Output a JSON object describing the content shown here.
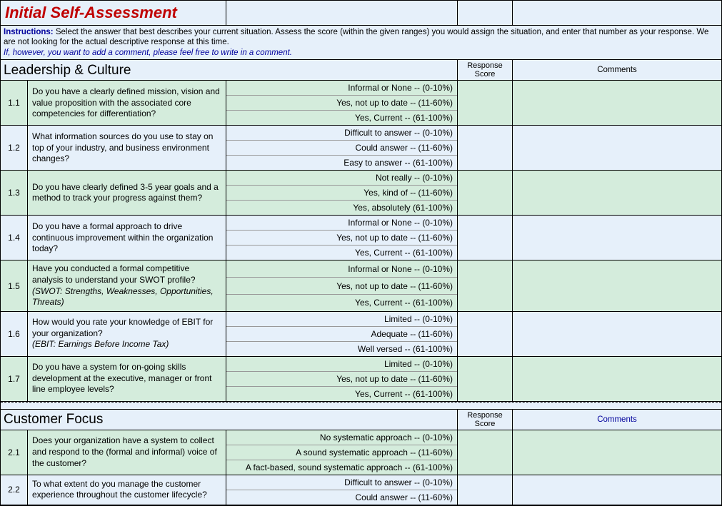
{
  "title": "Initial Self-Assessment",
  "instructions": {
    "label": "Instructions:",
    "text": "Select the answer that best describes your current situation.  Assess the score (within the given ranges) you would assign the situation, and enter that number as your response.  We are not looking for the actual descriptive response at this time.",
    "italic": "If, however, you want to add a comment, please feel free to write in a comment."
  },
  "sections": [
    {
      "title": "Leadership & Culture",
      "score_header": "Response Score",
      "comments_header": "Comments",
      "comments_blue": false,
      "questions": [
        {
          "num": "1.1",
          "green": true,
          "text": "Do you have a clearly defined mission, vision and value proposition with the associated core competencies for differentiation?",
          "italic": "",
          "options": [
            "Informal or None -- (0-10%)",
            "Yes, not up to date -- (11-60%)",
            "Yes, Current -- (61-100%)"
          ]
        },
        {
          "num": "1.2",
          "green": false,
          "text": "What information sources do you use to stay on top of your industry, and business environment changes?",
          "italic": "",
          "options": [
            "Difficult to answer -- (0-10%)",
            "Could answer -- (11-60%)",
            "Easy to answer -- (61-100%)"
          ]
        },
        {
          "num": "1.3",
          "green": true,
          "text": "Do you have clearly defined 3-5 year goals and a method to track your progress against them?",
          "italic": "",
          "options": [
            "Not really -- (0-10%)",
            "Yes, kind of -- (11-60%)",
            "Yes, absolutely (61-100%)"
          ]
        },
        {
          "num": "1.4",
          "green": false,
          "text": "Do you have a formal approach to drive continuous improvement within the organization today?",
          "italic": "",
          "options": [
            "Informal or None -- (0-10%)",
            "Yes, not up to date -- (11-60%)",
            "Yes, Current -- (61-100%)"
          ]
        },
        {
          "num": "1.5",
          "green": true,
          "text": "Have you conducted a formal competitive analysis to understand your SWOT profile?",
          "italic": "(SWOT: Strengths, Weaknesses, Opportunities, Threats)",
          "options": [
            "Informal or None -- (0-10%)",
            "Yes, not up to date -- (11-60%)",
            "Yes, Current -- (61-100%)"
          ]
        },
        {
          "num": "1.6",
          "green": false,
          "text": "How would you rate  your knowledge of EBIT for your organization?",
          "italic": "(EBIT: Earnings Before Income Tax)",
          "options": [
            "Limited -- (0-10%)",
            "Adequate -- (11-60%)",
            "Well versed -- (61-100%)"
          ]
        },
        {
          "num": "1.7",
          "green": true,
          "text": "Do you have a system for on-going skills development at the executive, manager or front line employee levels?",
          "italic": "",
          "options": [
            "Limited -- (0-10%)",
            "Yes, not up to date -- (11-60%)",
            "Yes, Current -- (61-100%)"
          ]
        }
      ]
    },
    {
      "title": "Customer Focus",
      "score_header": "Response Score",
      "comments_header": "Comments",
      "comments_blue": true,
      "questions": [
        {
          "num": "2.1",
          "green": true,
          "text": "Does your organization have a system to collect and respond to the (formal and informal) voice of the customer?",
          "italic": "",
          "options": [
            "No systematic approach -- (0-10%)",
            "A sound systematic approach -- (11-60%)",
            "A fact-based, sound systematic approach -- (61-100%)"
          ]
        },
        {
          "num": "2.2",
          "green": false,
          "text": "To what extent do you manage the customer experience throughout the customer lifecycle?",
          "italic": "",
          "options": [
            "Difficult to answer -- (0-10%)",
            "Could answer -- (11-60%)"
          ]
        }
      ]
    }
  ]
}
